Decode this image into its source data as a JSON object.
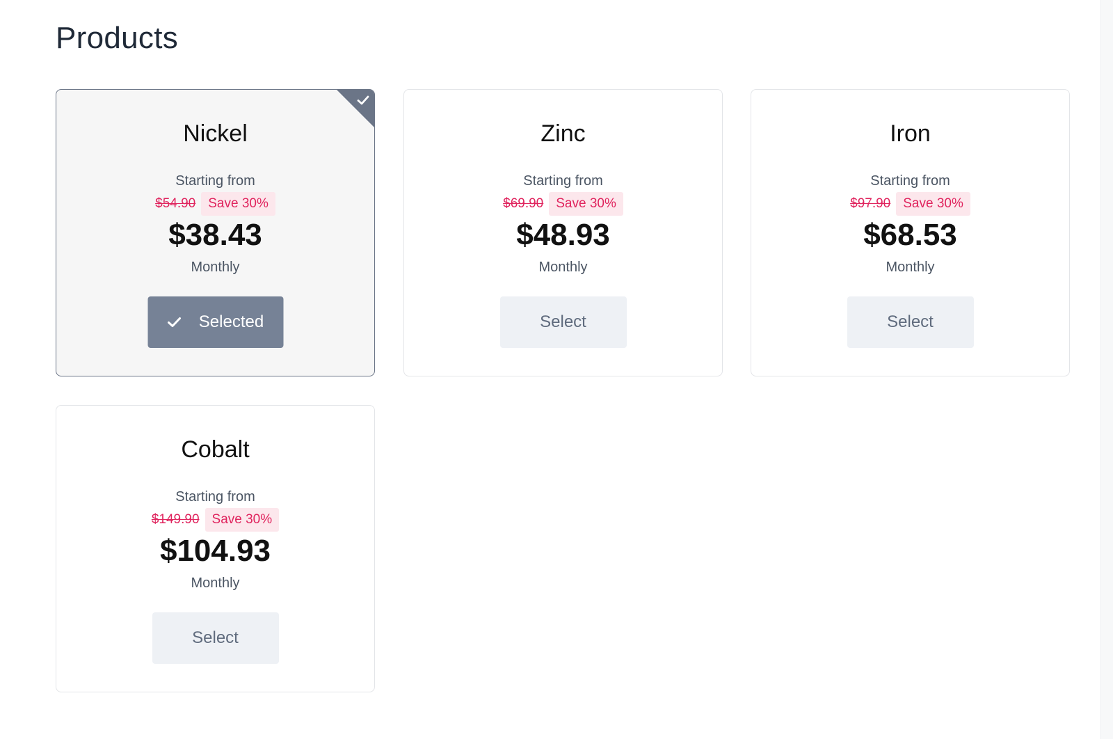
{
  "page": {
    "title": "Products"
  },
  "colors": {
    "selected_border": "#6b7587",
    "selected_button": "#768296",
    "select_button_bg": "#eef1f5",
    "discount_text": "#e0245e",
    "discount_badge_bg": "#fce7ec"
  },
  "products": [
    {
      "name": "Nickel",
      "starting_label": "Starting from",
      "old_price": "$54.90",
      "save_label": "Save 30%",
      "price": "$38.43",
      "period": "Monthly",
      "button_label": "Selected",
      "selected": true,
      "button_icon": "check-icon",
      "corner_icon": "check-icon"
    },
    {
      "name": "Zinc",
      "starting_label": "Starting from",
      "old_price": "$69.90",
      "save_label": "Save 30%",
      "price": "$48.93",
      "period": "Monthly",
      "button_label": "Select",
      "selected": false
    },
    {
      "name": "Iron",
      "starting_label": "Starting from",
      "old_price": "$97.90",
      "save_label": "Save 30%",
      "price": "$68.53",
      "period": "Monthly",
      "button_label": "Select",
      "selected": false
    },
    {
      "name": "Cobalt",
      "starting_label": "Starting from",
      "old_price": "$149.90",
      "save_label": "Save 30%",
      "price": "$104.93",
      "period": "Monthly",
      "button_label": "Select",
      "selected": false
    }
  ]
}
